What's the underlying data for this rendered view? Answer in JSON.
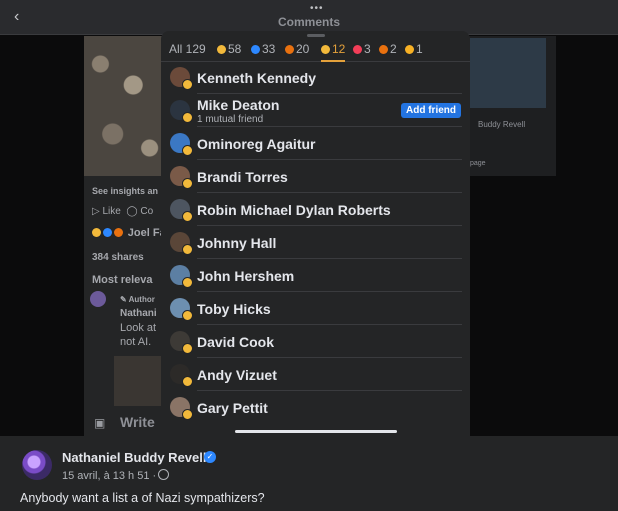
{
  "topbar": {
    "title": "Comments",
    "back_icon": "chevron-left-icon",
    "more_icon": "more-dots-icon"
  },
  "background_post": {
    "insights": "See insights an",
    "like": "Like",
    "comment_short": "Co",
    "reactors": "Joel Fa",
    "shares": "384 shares",
    "sort": "Most releva",
    "comment": {
      "badge": "Author",
      "name": "Nathani",
      "line1": "Look at",
      "line2": "not AI."
    },
    "write": "Write"
  },
  "background_right": {
    "name": "Buddy Revell",
    "page": "page"
  },
  "reactions_panel": {
    "tabs": [
      {
        "label": "All 129",
        "icon": "",
        "active": false
      },
      {
        "label": "58",
        "icon": "haha",
        "color": "#f2b93b",
        "active": false
      },
      {
        "label": "33",
        "icon": "like",
        "color": "#2d88ff",
        "active": false
      },
      {
        "label": "20",
        "icon": "angry",
        "color": "#e9710f",
        "active": false
      },
      {
        "label": "12",
        "icon": "haha",
        "color": "#f2b93b",
        "active": true
      },
      {
        "label": "3",
        "icon": "love",
        "color": "#f33e58",
        "active": false
      },
      {
        "label": "2",
        "icon": "angry",
        "color": "#e9710f",
        "active": false
      },
      {
        "label": "1",
        "icon": "wow",
        "color": "#f7b125",
        "active": false
      }
    ],
    "people": [
      {
        "name": "Kenneth Kennedy",
        "subtitle": "",
        "button": ""
      },
      {
        "name": "Mike Deaton",
        "subtitle": "1 mutual friend",
        "button": "Add friend"
      },
      {
        "name": "Ominoreg Agaitur",
        "subtitle": "",
        "button": ""
      },
      {
        "name": "Brandi Torres",
        "subtitle": "",
        "button": ""
      },
      {
        "name": "Robin Michael Dylan Roberts",
        "subtitle": "",
        "button": ""
      },
      {
        "name": "Johnny Hall",
        "subtitle": "",
        "button": ""
      },
      {
        "name": "John Hershem",
        "subtitle": "",
        "button": ""
      },
      {
        "name": "Toby Hicks",
        "subtitle": "",
        "button": ""
      },
      {
        "name": "David Cook",
        "subtitle": "",
        "button": ""
      },
      {
        "name": "Andy Vizuet",
        "subtitle": "",
        "button": ""
      },
      {
        "name": "Gary Pettit",
        "subtitle": "",
        "button": ""
      }
    ]
  },
  "footer_post": {
    "author": "Nathaniel Buddy Revell",
    "timestamp": "15 avril, à 13 h 51 ·",
    "text": "Anybody want a list a of Nazi sympathizers?"
  }
}
